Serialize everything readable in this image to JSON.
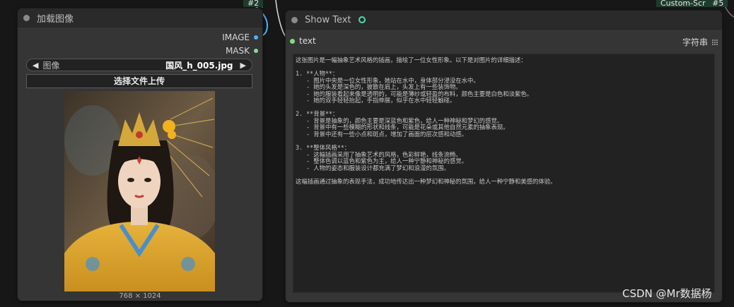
{
  "top_tags": {
    "left": "#2",
    "right": "Custom-Scr",
    "right_suffix": "#5"
  },
  "load_node": {
    "title": "加载图像",
    "outputs": [
      {
        "label": "IMAGE",
        "color": "#4fb3ff"
      },
      {
        "label": "MASK",
        "color": "#8fd99b"
      }
    ],
    "image_combo": {
      "label": "图像",
      "value": "国风_h_005.jpg"
    },
    "upload_button": "选择文件上传",
    "image_size": "768 × 1024"
  },
  "show_node": {
    "title": "Show Text",
    "input_label": "text",
    "type_label": "字符串",
    "content_lines": [
      "这张图片是一幅抽象艺术风格的插画，描绘了一位女性形象。以下是对图片的详细描述：",
      "",
      "1. **人物**：",
      "   - 图片中央是一位女性形象，她站在水中，身体部分浸没在水中。",
      "   - 她的头发是深色的，披散在肩上，头发上有一些装饰物。",
      "   - 她的服装看起来像是透明的，可能是薄纱或轻盈的布料，颜色主要是白色和淡紫色。",
      "   - 她的双手轻轻抬起，手指伸展，似乎在水中轻轻触碰。",
      "",
      "2. **背景**：",
      "   - 背景是抽象的，颜色主要是深蓝色和紫色，给人一种神秘和梦幻的感觉。",
      "   - 背景中有一些模糊的形状和线条，可能是花朵或其他自然元素的抽象表现。",
      "   - 背景中还有一些小点和斑点，增加了画面的层次感和动感。",
      "",
      "3. **整体风格**：",
      "   - 这幅插画采用了抽象艺术的风格，色彩鲜艳，线条流畅。",
      "   - 整体色调以蓝色和紫色为主，给人一种宁静和神秘的感觉。",
      "   - 人物的姿态和服装设计都充满了梦幻和浪漫的氛围。",
      "",
      "这幅插画通过抽象的表现手法，成功地传达出一种梦幻和神秘的氛围，给人一种宁静和美感的体验。"
    ]
  },
  "watermark": "CSDN @Mr数据杨",
  "colors": {
    "accent_blue": "#4fb3ff",
    "accent_green": "#8fd99b",
    "input_green": "#7be07b",
    "link_icon": "#4ad6a8"
  }
}
